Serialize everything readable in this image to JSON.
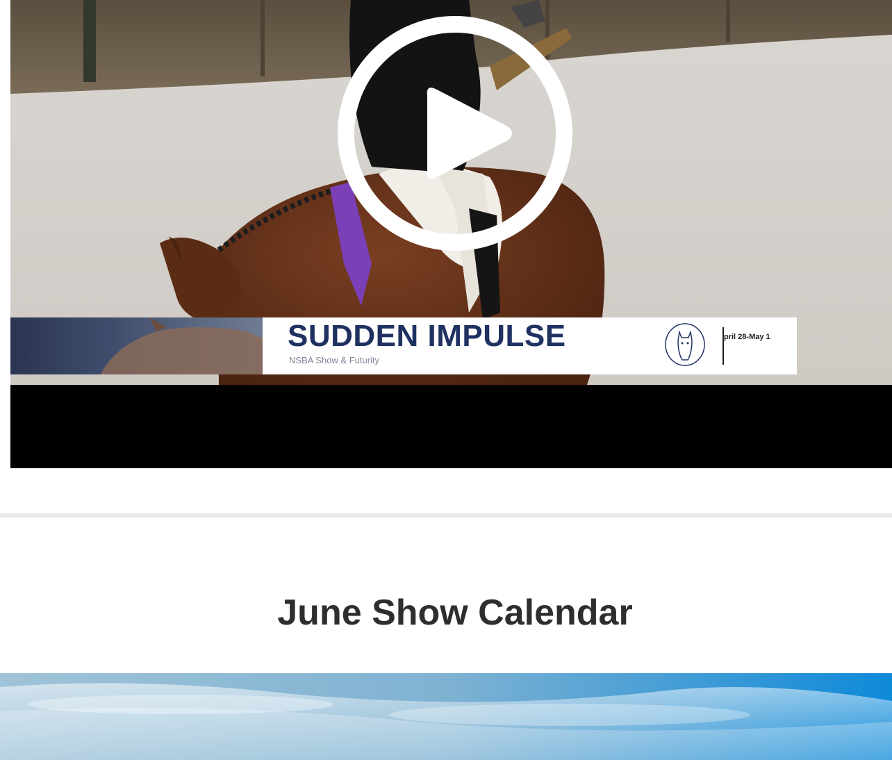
{
  "video": {
    "title": "SUDDEN IMPULSE",
    "subtitle": "NSBA Show & Futurity",
    "dates": "pril 28-May 1",
    "play_icon": "play-icon",
    "logo_icon": "horse-head-logo-icon"
  },
  "section": {
    "title": "June Show Calendar"
  },
  "colors": {
    "title_navy": "#1f3161",
    "heading": "#2e2e2e",
    "divider": "#e9e9ea",
    "sky": "#1a8fd6"
  }
}
